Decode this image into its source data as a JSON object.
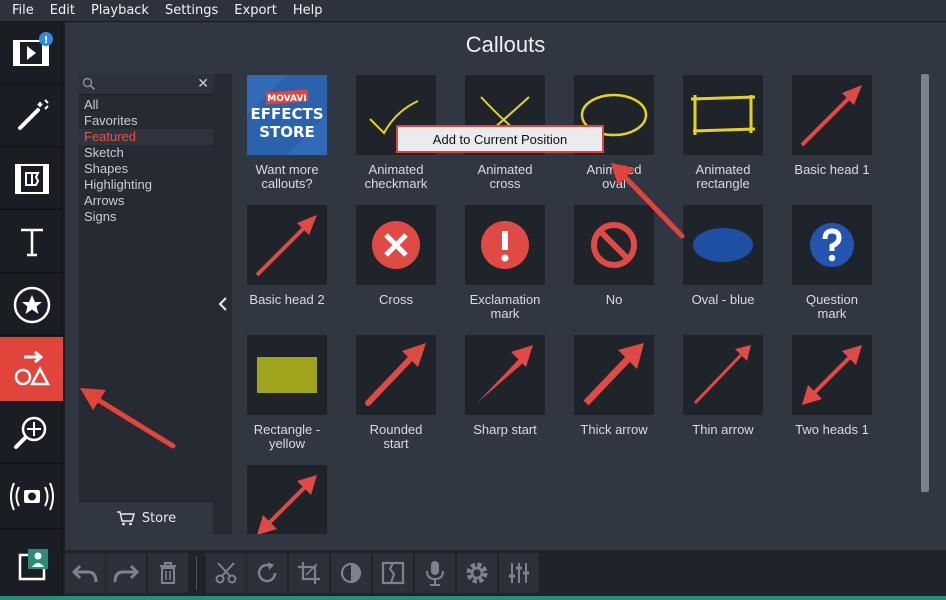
{
  "menu": [
    "File",
    "Edit",
    "Playback",
    "Settings",
    "Export",
    "Help"
  ],
  "panel": {
    "title": "Callouts"
  },
  "categories": [
    "All",
    "Favorites",
    "Featured",
    "Sketch",
    "Shapes",
    "Highlighting",
    "Arrows",
    "Signs"
  ],
  "selected_category": "Featured",
  "store": {
    "label": "Store"
  },
  "store_tile": {
    "brand": "MOVAVI",
    "line1": "EFFECTS",
    "line2": "STORE"
  },
  "context_menu": {
    "item": "Add to Current Position"
  },
  "callouts": [
    {
      "l1": "Want more",
      "l2": "callouts?"
    },
    {
      "l1": "Animated",
      "l2": "checkmark"
    },
    {
      "l1": "Animated",
      "l2": "cross"
    },
    {
      "l1": "Animated",
      "l2": "oval"
    },
    {
      "l1": "Animated",
      "l2": "rectangle"
    },
    {
      "l1": "Basic head 1",
      "l2": ""
    },
    {
      "l1": "Basic head 2",
      "l2": ""
    },
    {
      "l1": "Cross",
      "l2": ""
    },
    {
      "l1": "Exclamation",
      "l2": "mark"
    },
    {
      "l1": "No",
      "l2": ""
    },
    {
      "l1": "Oval - blue",
      "l2": ""
    },
    {
      "l1": "Question",
      "l2": "mark"
    },
    {
      "l1": "Rectangle -",
      "l2": "yellow"
    },
    {
      "l1": "Rounded",
      "l2": "start"
    },
    {
      "l1": "Sharp start",
      "l2": ""
    },
    {
      "l1": "Thick arrow",
      "l2": ""
    },
    {
      "l1": "Thin arrow",
      "l2": ""
    },
    {
      "l1": "Two heads 1",
      "l2": ""
    }
  ],
  "colors": {
    "accent": "#e0443b",
    "panel": "#313742",
    "arrow": "#e04a45",
    "oval_blue": "#1e4fa4",
    "rect_yellow": "#a0a41b"
  }
}
